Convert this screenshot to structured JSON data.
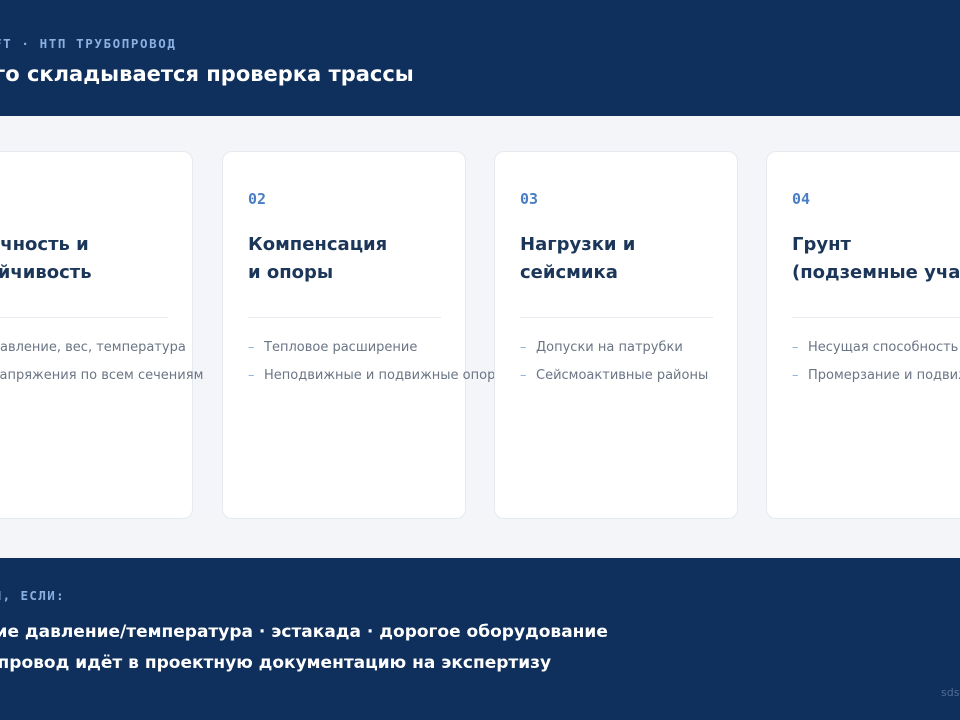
{
  "header": {
    "eyebrow": "FT · НТП ТРУБОПРОВОД",
    "title": "его складывается проверка трассы"
  },
  "cards": [
    {
      "num": "",
      "title": [
        "рочность и",
        "тойчивость"
      ],
      "items": [
        "давление, вес, температура",
        "напряжения по всем сечениям"
      ]
    },
    {
      "num": "02",
      "title": [
        "Компенсация",
        "и опоры"
      ],
      "items": [
        "Тепловое расширение",
        "Неподвижные и подвижные опоры"
      ]
    },
    {
      "num": "03",
      "title": [
        "Нагрузки и",
        "сейсмика"
      ],
      "items": [
        "Допуски на патрубки",
        "Сейсмоактивные районы"
      ]
    },
    {
      "num": "04",
      "title": [
        "Грунт",
        "(подземные участ"
      ],
      "items": [
        "Несущая способность",
        "Промерзание и подвиж"
      ]
    }
  ],
  "list_marker": "–",
  "footer": {
    "eyebrow": "ДЕЛЕН, ЕСЛИ:",
    "line1": "кие давление/температура · эстакада · дорогое оборудование",
    "line2": "бопровод идёт в проектную документацию на экспертизу",
    "watermark": "sds"
  },
  "colors": {
    "navy": "#0f2f5c",
    "accent": "#4a7ec4",
    "light_accent": "#8ab0e2",
    "card_bg": "#ffffff",
    "page_bg": "#f3f5f9"
  }
}
